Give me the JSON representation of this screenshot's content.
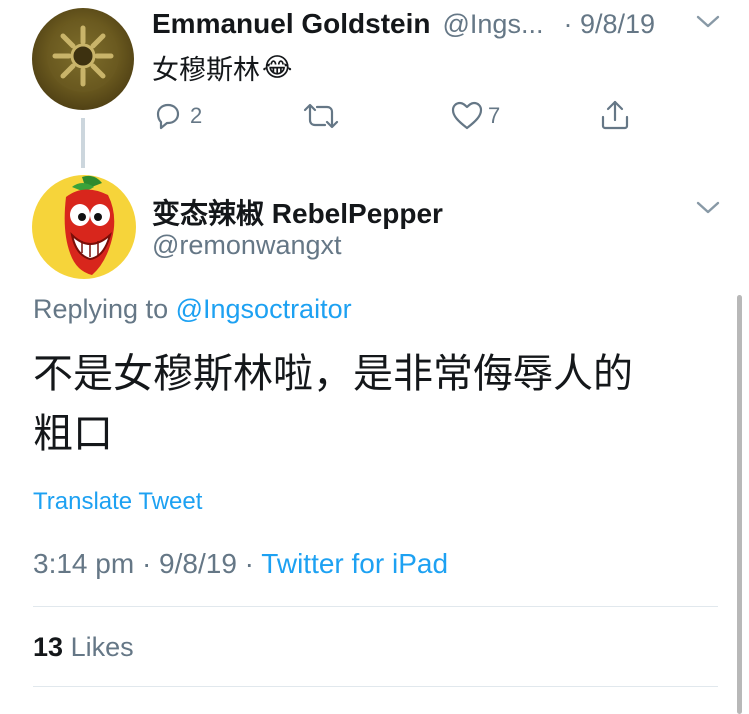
{
  "parent_tweet": {
    "name": "Emmanuel Goldstein",
    "handle": "@Ings...",
    "date": "· 9/8/19",
    "text": "女穆斯林",
    "emoji": "😂",
    "reply_count": "2",
    "like_count": "7"
  },
  "reply_tweet": {
    "name": "变态辣椒 RebelPepper",
    "handle": "@remonwangxt",
    "replying_label": "Replying to",
    "replying_handle": "@Ingsoctraitor",
    "text_line1": "不是女穆斯林啦，是非常侮辱人的",
    "text_line2": "粗口",
    "translate_label": "Translate Tweet",
    "time_date": "3:14 pm · 9/8/19 ·",
    "source": "Twitter for iPad",
    "likes_count": "13",
    "likes_label": "Likes"
  },
  "colors": {
    "link": "#1da1f2",
    "secondary_text": "#657786",
    "primary_text": "#14171a",
    "divider": "#e1e8ed"
  },
  "icons": [
    "reply-icon",
    "retweet-icon",
    "like-icon",
    "share-icon",
    "chevron-down-icon"
  ]
}
